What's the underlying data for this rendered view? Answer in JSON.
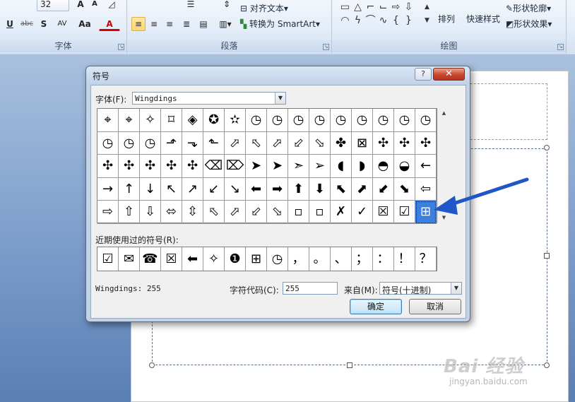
{
  "ribbon": {
    "font_group_label": "字体",
    "paragraph_group_label": "段落",
    "drawing_group_label": "绘图",
    "font_size_value": "32",
    "align_text_label": "对齐文本",
    "convert_smartart_label": "转换为 SmartArt",
    "arrange_label": "排列",
    "quick_styles_label": "快速样式",
    "shape_outline_label": "形状轮廓",
    "shape_effects_label": "形状效果",
    "underline_label": "U",
    "strike_label": "abc",
    "shadow_label": "S",
    "spacing_label": "AV",
    "case_label": "Aa",
    "font_color_label": "A",
    "grow_label": "A",
    "shrink_label": "A",
    "dropdown_glyph": "▾"
  },
  "dialog": {
    "title": "符号",
    "help_label": "?",
    "close_label": "✕",
    "font_label": "字体(F):",
    "font_value": "Wingdings",
    "recent_label": "近期使用过的符号(R):",
    "status_text": "Wingdings: 255",
    "char_code_label": "字符代码(C):",
    "char_code_value": "255",
    "from_label": "来自(M):",
    "from_value": "符号(十进制)",
    "ok_label": "确定",
    "cancel_label": "取消",
    "symbols": [
      "⌖",
      "⌖",
      "✧",
      "⌑",
      "◈",
      "✪",
      "✫",
      "◷",
      "◷",
      "◷",
      "◷",
      "◷",
      "◷",
      "◷",
      "◷",
      "◷",
      "◷",
      "◷",
      "◷",
      "⬏",
      "⬎",
      "⬑",
      "⬀",
      "⬁",
      "⬀",
      "⬃",
      "⬂",
      "✤",
      "⊠",
      "✣",
      "✣",
      "✣",
      "✣",
      "✣",
      "✣",
      "✣",
      "✣",
      "⌫",
      "⌦",
      "➤",
      "➤",
      "➣",
      "➢",
      "◖",
      "◗",
      "◓",
      "◒",
      "←",
      "→",
      "↑",
      "↓",
      "↖",
      "↗",
      "↙",
      "↘",
      "⬅",
      "➡",
      "⬆",
      "⬇",
      "⬉",
      "⬈",
      "⬋",
      "⬊",
      "⇦",
      "⇨",
      "⇧",
      "⇩",
      "⬄",
      "⇳",
      "⬁",
      "⬀",
      "⬃",
      "⬂",
      "▫",
      "▫",
      "✗",
      "✓",
      "☒",
      "☑",
      "⊞"
    ],
    "selected_index": 79,
    "recent_symbols": [
      "☑",
      "✉",
      "☎",
      "☒",
      "⬅",
      "✧",
      "❶",
      "⊞",
      "◷",
      "，",
      "。",
      "、",
      "；",
      "：",
      "！",
      "？"
    ]
  },
  "watermark": {
    "text": "Bai 经验",
    "url": "jingyan.baidu.com"
  },
  "colors": {
    "annotation_arrow": "#1f56c8",
    "selection": "#3c7fdc"
  }
}
